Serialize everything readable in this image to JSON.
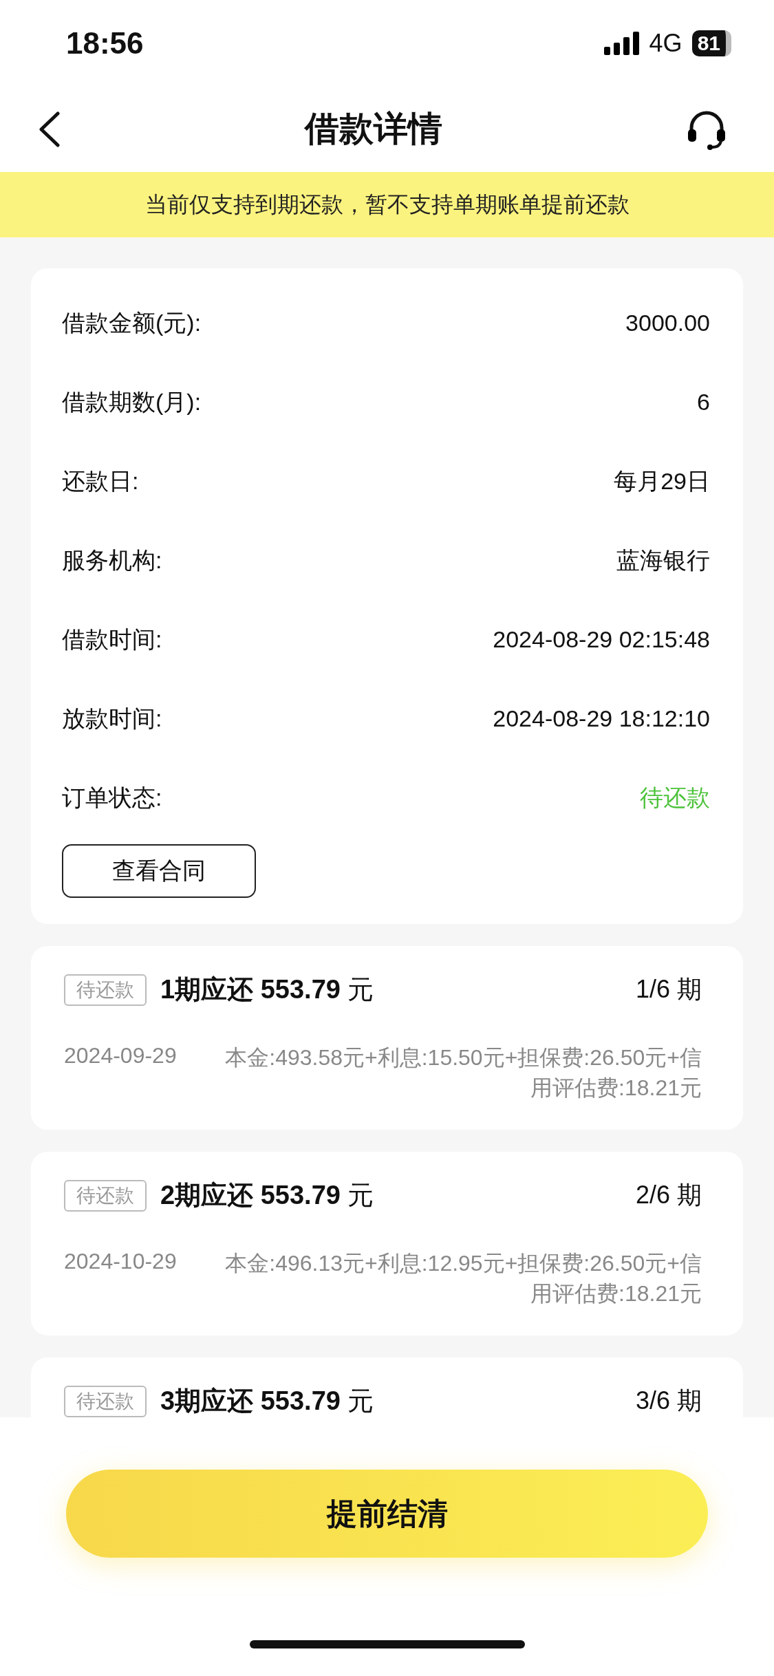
{
  "status_bar": {
    "time": "18:56",
    "network": "4G",
    "battery": "81"
  },
  "nav": {
    "title": "借款详情"
  },
  "notice": "当前仅支持到期还款，暂不支持单期账单提前还款",
  "details": [
    {
      "label": "借款金额(元):",
      "value": "3000.00",
      "kind": "text"
    },
    {
      "label": "借款期数(月):",
      "value": "6",
      "kind": "text"
    },
    {
      "label": "还款日:",
      "value": "每月29日",
      "kind": "text"
    },
    {
      "label": "服务机构:",
      "value": "蓝海银行",
      "kind": "text"
    },
    {
      "label": "借款时间:",
      "value": "2024-08-29 02:15:48",
      "kind": "text"
    },
    {
      "label": "放款时间:",
      "value": "2024-08-29 18:12:10",
      "kind": "text"
    },
    {
      "label": "订单状态:",
      "value": "待还款",
      "kind": "status"
    }
  ],
  "contract_button": "查看合同",
  "installments": [
    {
      "tag": "待还款",
      "title": "**1期应还 553.79** 元",
      "period": "1/6 期",
      "date": "2024-09-29",
      "breakdown": "本金:493.58元+利息:15.50元+担保费:26.50元+信用评估费:18.21元"
    },
    {
      "tag": "待还款",
      "title": "**2期应还 553.79** 元",
      "period": "2/6 期",
      "date": "2024-10-29",
      "breakdown": "本金:496.13元+利息:12.95元+担保费:26.50元+信用评估费:18.21元"
    },
    {
      "tag": "待还款",
      "title": "**3期应还 553.79** 元",
      "period": "3/6 期"
    }
  ],
  "settle_button": "提前结清"
}
